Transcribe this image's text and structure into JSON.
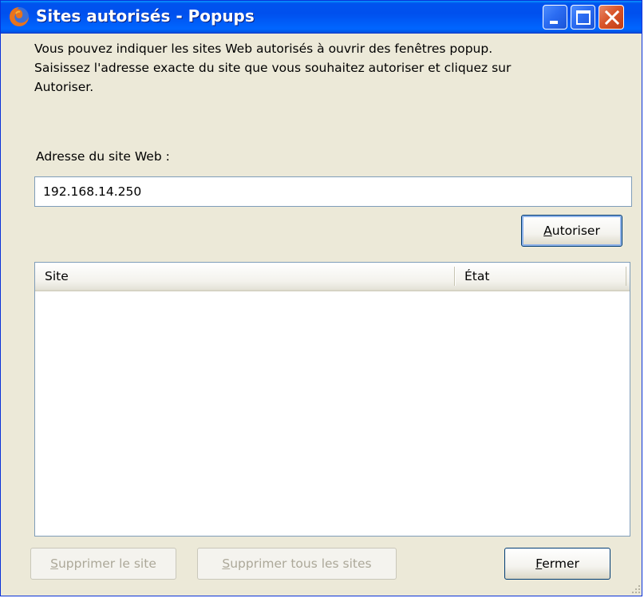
{
  "window": {
    "title": "Sites autorisés - Popups"
  },
  "description": "Vous pouvez indiquer les sites Web autorisés à ouvrir des fenêtres popup.\nSaisissez l'adresse exacte du site que vous souhaitez autoriser et cliquez sur\nAutoriser.",
  "address": {
    "label": "Adresse du site Web :",
    "value": "192.168.14.250"
  },
  "buttons": {
    "allow": {
      "accel": "A",
      "rest": "utoriser"
    },
    "remove_site": {
      "accel": "S",
      "rest": "upprimer le site"
    },
    "remove_all": {
      "accel": "S",
      "rest": "upprimer tous les sites"
    },
    "close": {
      "accel": "F",
      "rest": "ermer"
    }
  },
  "list": {
    "columns": [
      "Site",
      "État"
    ],
    "rows": []
  },
  "colors": {
    "titlebar": "#0053ee",
    "window_bg": "#ece9d8",
    "close_button": "#d9562c"
  },
  "icons": {
    "app": "firefox-icon",
    "minimize": "minimize-icon",
    "maximize": "maximize-icon",
    "close": "close-icon"
  }
}
